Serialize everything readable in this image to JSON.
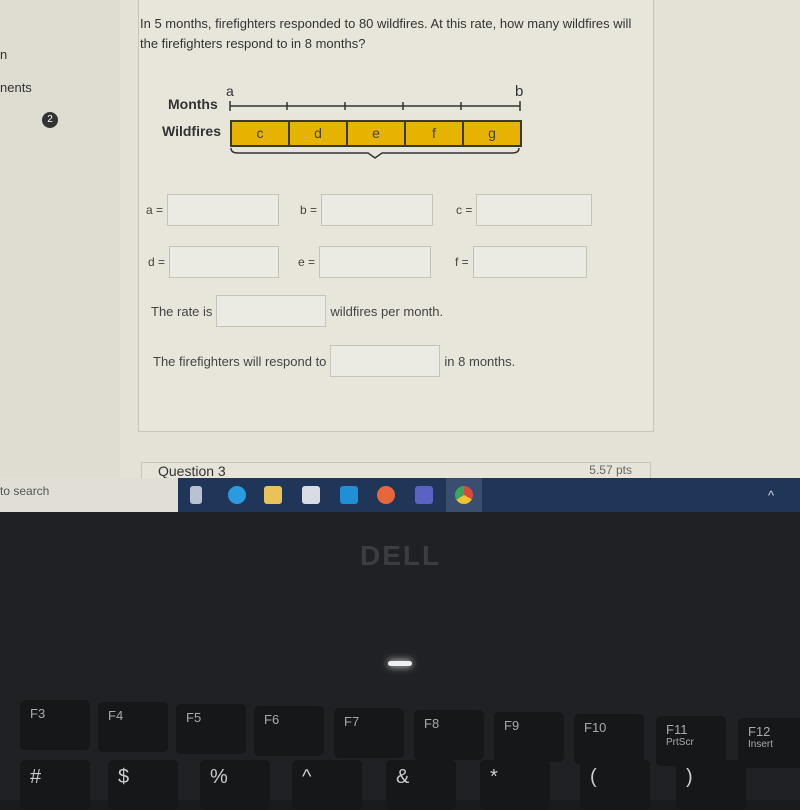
{
  "sidebar": {
    "item1": "n",
    "item2": "nents",
    "badge": "2"
  },
  "question": {
    "text": "In 5 months, firefighters responded to 80 wildfires. At this rate, how many wildfires will the firefighters respond to in 8 months?"
  },
  "diagram": {
    "months_label": "Months",
    "wildfires_label": "Wildfires",
    "a": "a",
    "b": "b",
    "segments": [
      "c",
      "d",
      "e",
      "f",
      "g"
    ],
    "bar_color": "#e6b400"
  },
  "fields": {
    "a": "a =",
    "b": "b =",
    "c": "c =",
    "d": "d =",
    "e": "e =",
    "f": "f ="
  },
  "rate": {
    "prefix": "The rate is",
    "suffix": "wildfires per month."
  },
  "respond": {
    "prefix": "The firefighters will respond to",
    "suffix": "in 8 months."
  },
  "next_question": {
    "title": "Question 3",
    "points": "5.57 pts"
  },
  "taskbar": {
    "search": "to search",
    "icons": [
      "task-view",
      "edge",
      "file-explorer",
      "store",
      "mail",
      "firefox",
      "teams",
      "chrome"
    ]
  },
  "laptop": {
    "brand": "DELL",
    "fkeys": [
      "F3",
      "F4",
      "F5",
      "F6",
      "F7",
      "F8",
      "F9",
      "F10",
      "F11",
      "F12"
    ],
    "fsub": {
      "F11": "PrtScr",
      "F12": "Insert"
    },
    "symbols": [
      "#",
      "$",
      "%",
      "^",
      "&",
      "*",
      "(",
      ")"
    ]
  }
}
